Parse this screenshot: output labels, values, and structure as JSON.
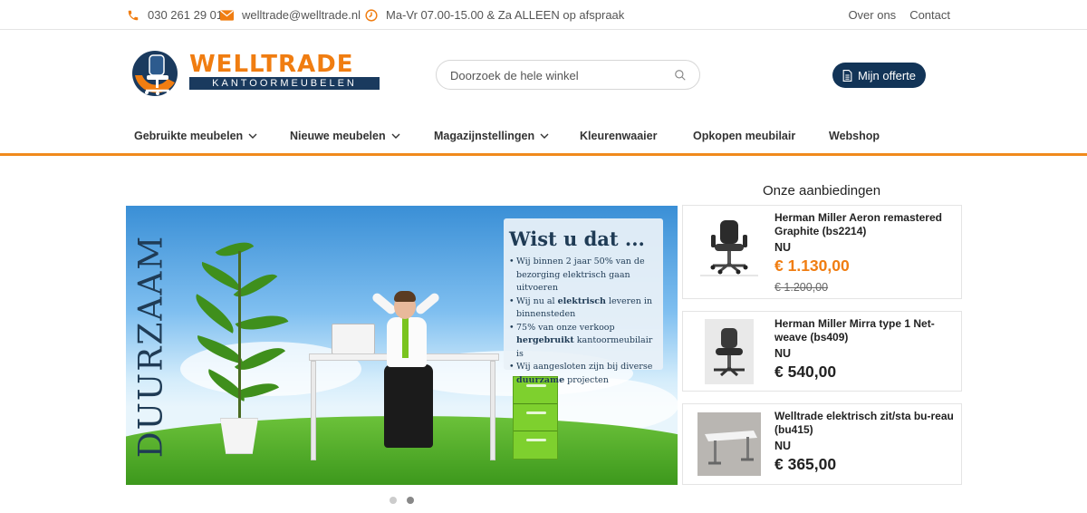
{
  "topbar": {
    "phone": "030 261 29 01",
    "email": "welltrade@welltrade.nl",
    "hours": "Ma-Vr 07.00-15.00 & Za ALLEEN op afspraak",
    "links": [
      "Over ons",
      "Contact"
    ]
  },
  "logo": {
    "word": "WELLTRADE",
    "sub": "KANTOORMEUBELEN"
  },
  "search": {
    "placeholder": "Doorzoek de hele winkel"
  },
  "header": {
    "offerte_label": "Mijn offerte"
  },
  "nav": {
    "items": [
      {
        "label": "Gebruikte meubelen",
        "dropdown": true
      },
      {
        "label": "Nieuwe meubelen",
        "dropdown": true
      },
      {
        "label": "Magazijnstellingen",
        "dropdown": true
      },
      {
        "label": "Kleurenwaaier",
        "dropdown": false
      },
      {
        "label": "Opkopen meubilair",
        "dropdown": false
      },
      {
        "label": "Webshop",
        "dropdown": false
      }
    ]
  },
  "banner": {
    "vertical_text": "DUURZAAM",
    "heading": "Wist u dat ...",
    "bullets": [
      {
        "pre": "Wij binnen 2 jaar 50% van de bezorging elektrisch gaan uitvoeren",
        "bold": "",
        "post": ""
      },
      {
        "pre": "Wij nu al ",
        "bold": "elektrisch",
        "post": " leveren in binnensteden"
      },
      {
        "pre": "75% van onze verkoop ",
        "bold": "hergebruikt",
        "post": " kantoormeubilair is"
      },
      {
        "pre": "Wij aangesloten zijn bij diverse ",
        "bold": "duurzame",
        "post": " projecten"
      }
    ],
    "slides": 2,
    "active_slide": 2
  },
  "offers": {
    "title": "Onze aanbiedingen",
    "items": [
      {
        "name": "Herman Miller Aeron remastered Graphite (bs2214)",
        "nu": "NU",
        "price": "€ 1.130,00",
        "old_price": "€ 1.200,00",
        "thumb_icon": "office-chair-icon"
      },
      {
        "name": "Herman Miller Mirra type 1 Net-weave (bs409)",
        "nu": "NU",
        "price": "€ 540,00",
        "old_price": "",
        "thumb_icon": "office-chair-icon"
      },
      {
        "name": "Welltrade elektrisch zit/sta bu-reau (bu415)",
        "nu": "NU",
        "price": "€ 365,00",
        "old_price": "",
        "thumb_icon": "desk-icon"
      }
    ]
  },
  "colors": {
    "accent": "#f07d11",
    "navy": "#123457",
    "nav_border": "#f08a1c"
  }
}
